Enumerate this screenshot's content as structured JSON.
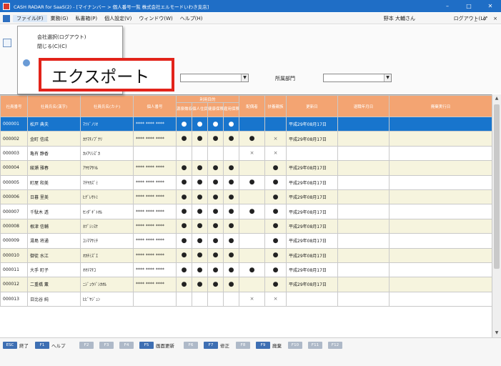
{
  "window": {
    "title": "CASH RADAR for SaaS(2) - [マイナンバー > 個人番号一覧 株式会社エルモードいわき支店]",
    "controls": [
      "–",
      "□",
      "✕"
    ]
  },
  "menubar": {
    "items": [
      "ファイル(F)",
      "業務(G)",
      "私書箱(P)",
      "個人設定(V)",
      "ウィンドウ(W)",
      "ヘルプ(H)"
    ],
    "user": "野本 大輔さん",
    "logout": "ログアウト(L)",
    "mini": "_ ♂ ×"
  },
  "file_menu": {
    "items": [
      "会社選択(ログアウト)",
      "閉じる(C)(C)"
    ]
  },
  "callout": {
    "text": "エクスポート"
  },
  "filters": {
    "dept_label": "所属部門"
  },
  "table": {
    "headers": [
      "社員番号",
      "社員氏名(漢字)",
      "社員氏名(カナ)",
      "個人番号",
      "源泉徴収",
      "個人住民税",
      "健康保険",
      "雇用保険",
      "配偶者",
      "扶養親族",
      "更新日",
      "退職年月日",
      "廃棄実行日"
    ],
    "group_header": "利用目的",
    "rows": [
      {
        "no": "000001",
        "kanji": "松戸 典夫",
        "kana": "ﾏﾂﾄﾞﾉﾘｵ",
        "num": "**** **** ****",
        "a": "●",
        "b": "●",
        "c": "●",
        "d": "●",
        "spouse": "",
        "dep": "",
        "date": "平成29年08月17日"
      },
      {
        "no": "000002",
        "kanji": "金町 信成",
        "kana": "ｶﾅﾏﾁﾉﾌﾞﾅﾘ",
        "num": "**** **** ****",
        "a": "●",
        "b": "●",
        "c": "●",
        "d": "●",
        "spouse": "●",
        "dep": "×",
        "date": "平成29年08月17日"
      },
      {
        "no": "000003",
        "kanji": "亀有 静香",
        "kana": "ｶﾒｱﾘｼｽﾞｶ",
        "num": "",
        "a": "",
        "b": "",
        "c": "",
        "d": "",
        "spouse": "×",
        "dep": "×",
        "date": ""
      },
      {
        "no": "000004",
        "kanji": "綾瀬 雅春",
        "kana": "ｱﾔｾﾏｻﾊﾙ",
        "num": "**** **** ****",
        "a": "●",
        "b": "●",
        "c": "●",
        "d": "●",
        "spouse": "",
        "dep": "●",
        "date": "平成29年08月17日"
      },
      {
        "no": "000005",
        "kanji": "町屋 和美",
        "kana": "ﾏﾁﾔｶｽﾞﾐ",
        "num": "**** **** ****",
        "a": "●",
        "b": "●",
        "c": "●",
        "d": "●",
        "spouse": "●",
        "dep": "●",
        "date": "平成29年08月17日"
      },
      {
        "no": "000006",
        "kanji": "日暮 里美",
        "kana": "ﾋｸﾞﾚｻﾄﾐ",
        "num": "**** **** ****",
        "a": "●",
        "b": "●",
        "c": "●",
        "d": "●",
        "spouse": "",
        "dep": "●",
        "date": "平成29年08月17日"
      },
      {
        "no": "000007",
        "kanji": "千駄木 透",
        "kana": "ｾﾝﾀﾞｷﾞﾄｵﾙ",
        "num": "**** **** ****",
        "a": "●",
        "b": "●",
        "c": "●",
        "d": "●",
        "spouse": "●",
        "dep": "●",
        "date": "平成29年08月17日"
      },
      {
        "no": "000008",
        "kanji": "根津 信輔",
        "kana": "ﾈﾂﾞｼﾝｽｹ",
        "num": "**** **** ****",
        "a": "●",
        "b": "●",
        "c": "●",
        "d": "●",
        "spouse": "",
        "dep": "●",
        "date": "平成29年08月17日"
      },
      {
        "no": "000009",
        "kanji": "湯島 将通",
        "kana": "ﾕｼﾏﾏｻﾐﾁ",
        "num": "**** **** ****",
        "a": "●",
        "b": "●",
        "c": "●",
        "d": "●",
        "spouse": "",
        "dep": "●",
        "date": "平成29年08月17日"
      },
      {
        "no": "000010",
        "kanji": "御徒 水江",
        "kana": "ｵｶﾁﾐｽﾞｴ",
        "num": "**** **** ****",
        "a": "●",
        "b": "●",
        "c": "●",
        "d": "●",
        "spouse": "",
        "dep": "●",
        "date": "平成29年08月17日"
      },
      {
        "no": "000011",
        "kanji": "大手 町子",
        "kana": "ｵｵﾃﾏﾁｺ",
        "num": "**** **** ****",
        "a": "●",
        "b": "●",
        "c": "●",
        "d": "●",
        "spouse": "●",
        "dep": "●",
        "date": "平成29年08月17日"
      },
      {
        "no": "000012",
        "kanji": "二重橋 薫",
        "kana": "ﾆｼﾞｭｳﾊﾞｼｶｵﾙ",
        "num": "**** **** ****",
        "a": "●",
        "b": "●",
        "c": "●",
        "d": "●",
        "spouse": "",
        "dep": "●",
        "date": "平成29年08月17日"
      },
      {
        "no": "000013",
        "kanji": "日比谷 純",
        "kana": "ﾋﾋﾞﾔｼﾞｭﾝ",
        "num": "",
        "a": "",
        "b": "",
        "c": "",
        "d": "",
        "spouse": "×",
        "dep": "×",
        "date": ""
      }
    ]
  },
  "fkeys": [
    {
      "code": "ESC",
      "label": "終了",
      "on": true
    },
    {
      "code": "F1",
      "label": "ヘルプ",
      "on": true
    },
    {
      "code": "F2",
      "label": "",
      "on": false
    },
    {
      "code": "F3",
      "label": "",
      "on": false
    },
    {
      "code": "F4",
      "label": "",
      "on": false
    },
    {
      "code": "F5",
      "label": "画面更新",
      "on": true
    },
    {
      "code": "F6",
      "label": "",
      "on": false
    },
    {
      "code": "F7",
      "label": "修正",
      "on": true
    },
    {
      "code": "F8",
      "label": "",
      "on": false
    },
    {
      "code": "F9",
      "label": "廃棄",
      "on": true
    },
    {
      "code": "F10",
      "label": "",
      "on": false
    },
    {
      "code": "F11",
      "label": "",
      "on": false
    },
    {
      "code": "F12",
      "label": "",
      "on": false
    }
  ]
}
